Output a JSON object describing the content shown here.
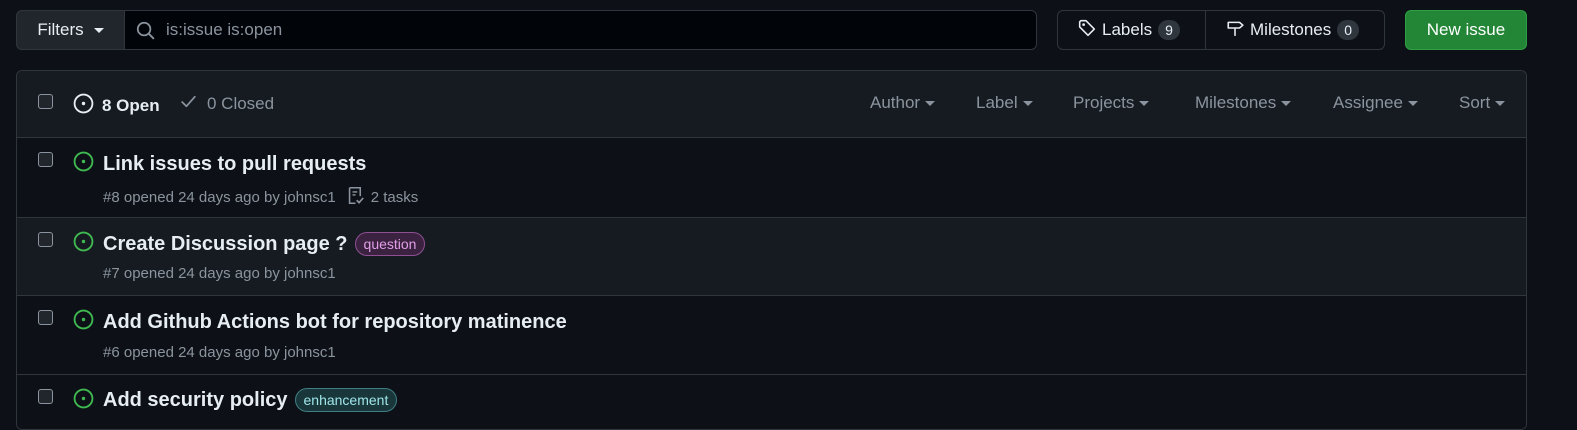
{
  "toolbar": {
    "filters_label": "Filters",
    "search_value": "is:issue is:open",
    "labels_label": "Labels",
    "labels_count": "9",
    "milestones_label": "Milestones",
    "milestones_count": "0",
    "new_issue_label": "New issue"
  },
  "header": {
    "open_label": "8 Open",
    "closed_label": "0 Closed",
    "filters": [
      "Author",
      "Label",
      "Projects",
      "Milestones",
      "Assignee",
      "Sort"
    ]
  },
  "issues": [
    {
      "title": "Link issues to pull requests",
      "meta": "#8 opened 24 days ago by johnsc1",
      "tasks": "2 tasks",
      "label": null
    },
    {
      "title": "Create Discussion page ?",
      "meta": "#7 opened 24 days ago by johnsc1",
      "label": "question"
    },
    {
      "title": "Add Github Actions bot for repository matinence",
      "meta": "#6 opened 24 days ago by johnsc1",
      "label": null
    },
    {
      "title": "Add security policy",
      "label": "enhancement"
    }
  ],
  "colors": {
    "open_icon": "#3fb950",
    "accent_button": "#238636",
    "background": "#0d1117"
  }
}
